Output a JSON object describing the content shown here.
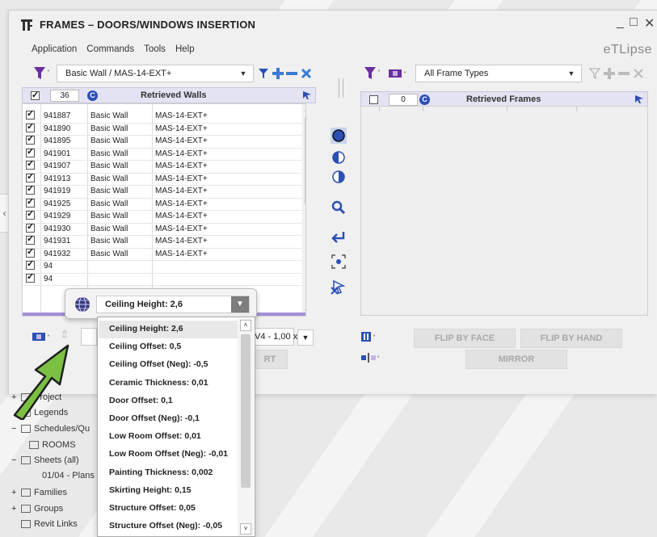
{
  "window": {
    "title": "FRAMES – DOORS/WINDOWS INSERTION",
    "brand": "eTLipse",
    "minimize_glyph": "_",
    "maximize_glyph": "□",
    "close_glyph": "✕"
  },
  "menu": [
    "Application",
    "Commands",
    "Tools",
    "Help"
  ],
  "left_panel": {
    "wall_type_filter": "Basic Wall / MAS-14-EXT+",
    "count": "36",
    "header_label": "Retrieved Walls",
    "rows": [
      {
        "id": "941887",
        "family": "Basic Wall",
        "type": "MAS-14-EXT+"
      },
      {
        "id": "941890",
        "family": "Basic Wall",
        "type": "MAS-14-EXT+"
      },
      {
        "id": "941895",
        "family": "Basic Wall",
        "type": "MAS-14-EXT+"
      },
      {
        "id": "941901",
        "family": "Basic Wall",
        "type": "MAS-14-EXT+"
      },
      {
        "id": "941907",
        "family": "Basic Wall",
        "type": "MAS-14-EXT+"
      },
      {
        "id": "941913",
        "family": "Basic Wall",
        "type": "MAS-14-EXT+"
      },
      {
        "id": "941919",
        "family": "Basic Wall",
        "type": "MAS-14-EXT+"
      },
      {
        "id": "941925",
        "family": "Basic Wall",
        "type": "MAS-14-EXT+"
      },
      {
        "id": "941929",
        "family": "Basic Wall",
        "type": "MAS-14-EXT+"
      },
      {
        "id": "941930",
        "family": "Basic Wall",
        "type": "MAS-14-EXT+"
      },
      {
        "id": "941931",
        "family": "Basic Wall",
        "type": "MAS-14-EXT+"
      },
      {
        "id": "941932",
        "family": "Basic Wall",
        "type": "MAS-14-EXT+"
      },
      {
        "id": "94",
        "family": "",
        "type": ""
      },
      {
        "id": "94",
        "family": "",
        "type": ""
      }
    ],
    "partial_combo": "V4 - 1,00 x",
    "partial_button": "RT"
  },
  "right_panel": {
    "frame_type_filter": "All Frame Types",
    "count": "0",
    "header_label": "Retrieved Frames",
    "flip_by_face": "FLIP BY FACE",
    "flip_by_hand": "FLIP BY HAND",
    "mirror": "MIRROR"
  },
  "popup": {
    "selected": "Ceiling Height: 2,6",
    "options": [
      "Ceiling Height: 2,6",
      "Ceiling Offset: 0,5",
      "Ceiling Offset (Neg): -0,5",
      "Ceramic Thickness: 0,01",
      "Door Offset: 0,1",
      "Door Offset (Neg): -0,1",
      "Low Room Offset: 0,01",
      "Low Room Offset (Neg): -0,01",
      "Painting Thickness: 0,002",
      "Skirting Height: 0,15",
      "Structure Offset: 0,05",
      "Structure Offset (Neg): -0,05"
    ]
  },
  "project_browser": {
    "items": [
      {
        "expander": "+",
        "label": "Project",
        "icon": "project-icon"
      },
      {
        "expander": "",
        "label": "Legends",
        "icon": "legends-icon"
      },
      {
        "expander": "−",
        "label": "Schedules/Qu",
        "icon": "schedules-icon"
      },
      {
        "expander": "",
        "label": "ROOMS",
        "icon": "schedule-item-icon"
      },
      {
        "expander": "−",
        "label": "Sheets (all)",
        "icon": "sheets-icon"
      },
      {
        "expander": "",
        "label": "01/04 - Plans",
        "icon": ""
      },
      {
        "expander": "+",
        "label": "Families",
        "icon": "families-icon"
      },
      {
        "expander": "+",
        "label": "Groups",
        "icon": "groups-icon"
      },
      {
        "expander": "",
        "label": "Revit Links",
        "icon": "revit-links-icon"
      }
    ]
  },
  "colors": {
    "accent_blue": "#2c4fb5",
    "filter_purple": "#6b2fa0",
    "add_blue": "#3a7bd5",
    "arrow_green": "#7bc043"
  }
}
